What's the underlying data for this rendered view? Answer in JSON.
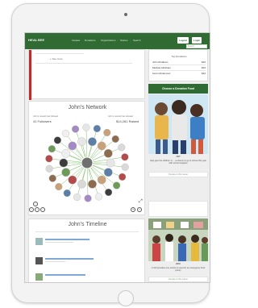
{
  "navbar": {
    "brand": "HEALSEE",
    "links": [
      "Causes",
      "Donations",
      "Organizations",
      "Stories",
      "Search"
    ],
    "buttons": [
      "Logout",
      "Login"
    ],
    "search_placeholder": "Search..."
  },
  "top_card": {
    "see_more": "+ See more"
  },
  "side_box": {
    "heading": "Top Donations",
    "rows": [
      {
        "name": "John Abraham",
        "amount": "$10"
      },
      {
        "name": "Melissa Abraham",
        "amount": "$10"
      },
      {
        "name": "Kevin Abramovic",
        "amount": "$10"
      }
    ]
  },
  "network": {
    "title": "John's Network",
    "left_stat_label": "John's network has followed",
    "left_stat_value": "41 Followers",
    "right_stat_label": "John's network has donated",
    "right_stat_value": "$14,281 Raised"
  },
  "timeline": {
    "title": "John's Timeline"
  },
  "donation": {
    "heading": "Choose a Donation Fund",
    "kids_label": "JOY",
    "kids_caption": "Help give the children in ... a chance to go to school this year with school supplies",
    "kids_cta": "Donate to this cause",
    "school_label": "EDU",
    "school_caption": "2,310 provides one school in need for an emergency food pantry",
    "school_cta": "Donate to this cause"
  },
  "colors": {
    "brand_green": "#2f6b32",
    "accent_red": "#c62828",
    "network_line": "#7fbf6a"
  }
}
